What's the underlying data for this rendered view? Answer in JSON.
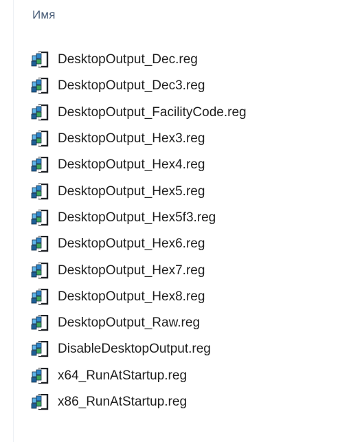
{
  "header": {
    "name_column": "Имя"
  },
  "file_icon": "registry-file-icon",
  "files": [
    "DesktopOutput_Dec.reg",
    "DesktopOutput_Dec3.reg",
    "DesktopOutput_FacilityCode.reg",
    "DesktopOutput_Hex3.reg",
    "DesktopOutput_Hex4.reg",
    "DesktopOutput_Hex5.reg",
    "DesktopOutput_Hex5f3.reg",
    "DesktopOutput_Hex6.reg",
    "DesktopOutput_Hex7.reg",
    "DesktopOutput_Hex8.reg",
    "DesktopOutput_Raw.reg",
    "DisableDesktopOutput.reg",
    "x64_RunAtStartup.reg",
    "x86_RunAtStartup.reg"
  ]
}
